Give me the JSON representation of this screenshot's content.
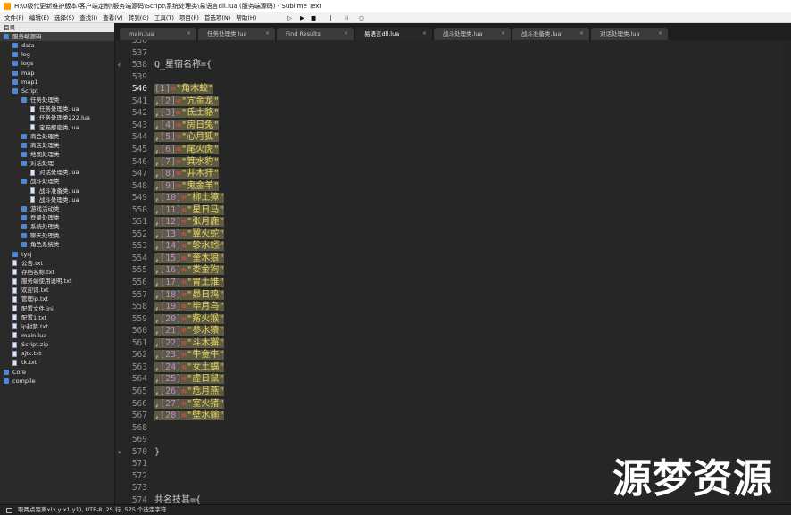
{
  "window": {
    "title": "H:\\0级代更新维护版本\\客户端定制\\服务端源码\\Script\\系统处理类\\易语言dll.lua (服务端源码) - Sublime Text"
  },
  "menu": {
    "items": [
      "文件(F)",
      "编辑(E)",
      "选择(S)",
      "查找(I)",
      "查看(V)",
      "转到(G)",
      "工具(T)",
      "项目(P)",
      "首选项(N)",
      "帮助(H)"
    ],
    "controls": [
      "▷",
      "▶",
      "■",
      "❘",
      "⁞⁞",
      "○"
    ]
  },
  "sidebar": {
    "header": "目录",
    "items": [
      {
        "label": "服务端源码",
        "kind": "folder",
        "indent": 0,
        "selected": true
      },
      {
        "label": "data",
        "kind": "folder",
        "indent": 1
      },
      {
        "label": "log",
        "kind": "folder",
        "indent": 1
      },
      {
        "label": "logs",
        "kind": "folder",
        "indent": 1
      },
      {
        "label": "map",
        "kind": "folder",
        "indent": 1
      },
      {
        "label": "map1",
        "kind": "folder",
        "indent": 1
      },
      {
        "label": "Script",
        "kind": "folder",
        "indent": 1
      },
      {
        "label": "任务处理类",
        "kind": "folder",
        "indent": 2
      },
      {
        "label": "任务处理类.lua",
        "kind": "file",
        "indent": 3
      },
      {
        "label": "任务处理类222.lua",
        "kind": "file",
        "indent": 3
      },
      {
        "label": "宝箱解密类.lua",
        "kind": "file",
        "indent": 3
      },
      {
        "label": "商会处理类",
        "kind": "folder",
        "indent": 2
      },
      {
        "label": "商店处理类",
        "kind": "folder",
        "indent": 2
      },
      {
        "label": "地图处理类",
        "kind": "folder",
        "indent": 2
      },
      {
        "label": "对话处理",
        "kind": "folder",
        "indent": 2
      },
      {
        "label": "对话处理类.lua",
        "kind": "file",
        "indent": 3
      },
      {
        "label": "战斗处理类",
        "kind": "folder",
        "indent": 2
      },
      {
        "label": "战斗准备类.lua",
        "kind": "file",
        "indent": 3
      },
      {
        "label": "战斗处理类.lua",
        "kind": "file",
        "indent": 3
      },
      {
        "label": "游戏活动类",
        "kind": "folder",
        "indent": 2
      },
      {
        "label": "登录处理类",
        "kind": "folder",
        "indent": 2
      },
      {
        "label": "系统处理类",
        "kind": "folder",
        "indent": 2
      },
      {
        "label": "聊天处理类",
        "kind": "folder",
        "indent": 2
      },
      {
        "label": "角色系统类",
        "kind": "folder",
        "indent": 2
      },
      {
        "label": "tysj",
        "kind": "folder",
        "indent": 1
      },
      {
        "label": "公告.txt",
        "kind": "file",
        "indent": 1
      },
      {
        "label": "存档名称.txt",
        "kind": "file",
        "indent": 1
      },
      {
        "label": "服务端使用说明.txt",
        "kind": "file",
        "indent": 1
      },
      {
        "label": "欢迎词.txt",
        "kind": "file",
        "indent": 1
      },
      {
        "label": "管理ip.txt",
        "kind": "file",
        "indent": 1
      },
      {
        "label": "配置文件.ini",
        "kind": "file",
        "indent": 1
      },
      {
        "label": "配置1.txt",
        "kind": "file",
        "indent": 1
      },
      {
        "label": "ip封禁.txt",
        "kind": "file",
        "indent": 1
      },
      {
        "label": "main.lua",
        "kind": "file",
        "indent": 1
      },
      {
        "label": "Script.zip",
        "kind": "file",
        "indent": 1
      },
      {
        "label": "sjtk.txt",
        "kind": "file",
        "indent": 1
      },
      {
        "label": "tk.txt",
        "kind": "file",
        "indent": 1
      },
      {
        "label": "Core",
        "kind": "folder",
        "indent": 0
      },
      {
        "label": "compile",
        "kind": "folder",
        "indent": 0
      }
    ]
  },
  "tabs": [
    {
      "label": "main.lua",
      "active": false
    },
    {
      "label": "任务处理类.lua",
      "active": false
    },
    {
      "label": "Find Results",
      "active": false
    },
    {
      "label": "易语言dll.lua",
      "active": true
    },
    {
      "label": "战斗处理类.lua",
      "active": false
    },
    {
      "label": "战斗准备类.lua",
      "active": false
    },
    {
      "label": "对话处理类.lua",
      "active": false
    }
  ],
  "tab_close": "×",
  "editor": {
    "lines": [
      {
        "n": "536",
        "code": ""
      },
      {
        "n": "537",
        "code": ""
      },
      {
        "n": "538",
        "code": "Q_星宿名称={",
        "gutter": "‹"
      },
      {
        "n": "539",
        "code": ""
      },
      {
        "n": "540",
        "i": "1",
        "s": "角木蛟",
        "first": true
      },
      {
        "n": "541",
        "i": "2",
        "s": "亢金龙"
      },
      {
        "n": "542",
        "i": "3",
        "s": "氐土貉"
      },
      {
        "n": "543",
        "i": "4",
        "s": "房日兔"
      },
      {
        "n": "544",
        "i": "5",
        "s": "心月狐"
      },
      {
        "n": "545",
        "i": "6",
        "s": "尾火虎"
      },
      {
        "n": "546",
        "i": "7",
        "s": "箕水豹"
      },
      {
        "n": "547",
        "i": "8",
        "s": "井木犴"
      },
      {
        "n": "548",
        "i": "9",
        "s": "鬼金羊"
      },
      {
        "n": "549",
        "i": "10",
        "s": "柳土獐"
      },
      {
        "n": "550",
        "i": "11",
        "s": "星日马"
      },
      {
        "n": "551",
        "i": "12",
        "s": "张月鹿"
      },
      {
        "n": "552",
        "i": "13",
        "s": "翼火蛇"
      },
      {
        "n": "553",
        "i": "14",
        "s": "轸水蚓"
      },
      {
        "n": "554",
        "i": "15",
        "s": "奎木狼"
      },
      {
        "n": "555",
        "i": "16",
        "s": "娄金狗"
      },
      {
        "n": "556",
        "i": "17",
        "s": "胃土雉"
      },
      {
        "n": "557",
        "i": "18",
        "s": "昴日鸡"
      },
      {
        "n": "558",
        "i": "19",
        "s": "毕月乌"
      },
      {
        "n": "559",
        "i": "20",
        "s": "觜火猴"
      },
      {
        "n": "560",
        "i": "21",
        "s": "参水猿"
      },
      {
        "n": "561",
        "i": "22",
        "s": "斗木獬"
      },
      {
        "n": "562",
        "i": "23",
        "s": "牛金牛"
      },
      {
        "n": "563",
        "i": "24",
        "s": "女土蝠"
      },
      {
        "n": "564",
        "i": "25",
        "s": "虚日鼠"
      },
      {
        "n": "565",
        "i": "26",
        "s": "危月燕"
      },
      {
        "n": "566",
        "i": "27",
        "s": "室火猪"
      },
      {
        "n": "567",
        "i": "28",
        "s": "壁水貐"
      },
      {
        "n": "568",
        "code": ""
      },
      {
        "n": "569",
        "code": ""
      },
      {
        "n": "570",
        "code": "}",
        "gutter": "›"
      },
      {
        "n": "571",
        "code": ""
      },
      {
        "n": "572",
        "code": ""
      },
      {
        "n": "573",
        "code": ""
      },
      {
        "n": "574",
        "code": "共名技其={"
      }
    ],
    "watermark": "源梦资源"
  },
  "status": {
    "text": "取两点距离x(x,y,x1,y1), UTF-8, 25 行, 575 个选定字符"
  },
  "colors": {
    "index": "#b98adf",
    "equals": "#ef4d4d",
    "string": "#e8d66a",
    "selection": "#5c5a3f"
  }
}
